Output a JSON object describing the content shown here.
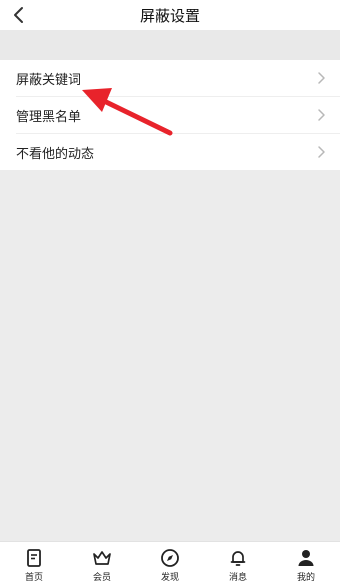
{
  "header": {
    "title": "屏蔽设置",
    "back_icon": "chevron-left-icon"
  },
  "settings": {
    "items": [
      {
        "label": "屏蔽关键词",
        "icon": "chevron-right-icon"
      },
      {
        "label": "管理黑名单",
        "icon": "chevron-right-icon"
      },
      {
        "label": "不看他的动态",
        "icon": "chevron-right-icon"
      }
    ]
  },
  "annotation": {
    "icon": "arrow-icon",
    "color": "#e8232b"
  },
  "tabbar": {
    "items": [
      {
        "label": "首页",
        "icon": "home-icon"
      },
      {
        "label": "会员",
        "icon": "crown-icon"
      },
      {
        "label": "发现",
        "icon": "compass-icon"
      },
      {
        "label": "消息",
        "icon": "bell-icon"
      },
      {
        "label": "我的",
        "icon": "user-icon"
      }
    ]
  },
  "colors": {
    "background": "#ececec",
    "surface": "#ffffff",
    "chevron": "#b8b8b8",
    "text": "#222222"
  }
}
